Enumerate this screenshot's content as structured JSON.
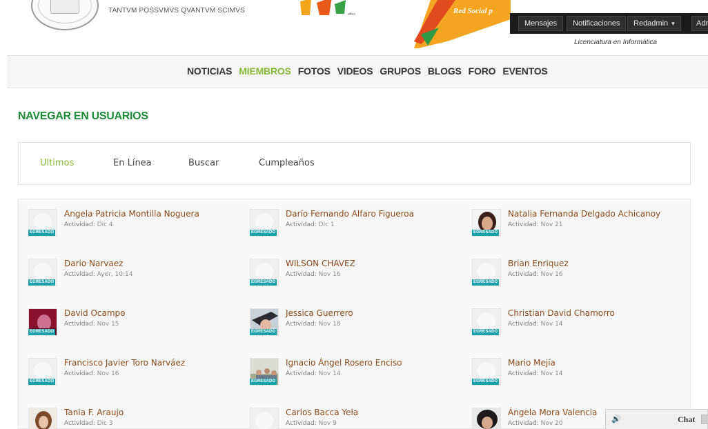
{
  "header": {
    "motto": "TANTVM POSSVMVS QVANTVM SCIMVS",
    "brand_title": "Red Social p",
    "brand_subtitle": "Licenciatura en Informática",
    "logo_suffix": "años"
  },
  "userbar": {
    "messages": "Mensajes",
    "notifications": "Notificaciones",
    "user": "Redadmin",
    "admin": "Adm"
  },
  "nav": {
    "items": [
      "NOTICIAS",
      "MIEMBROS",
      "FOTOS",
      "VIDEOS",
      "GRUPOS",
      "BLOGS",
      "FORO",
      "EVENTOS"
    ],
    "active": "MIEMBROS"
  },
  "page_title": "NAVEGAR EN USUARIOS",
  "filter_tabs": {
    "items": [
      "Ultimos",
      "En Línea",
      "Buscar",
      "Cumpleaños"
    ],
    "active": "Ultimos"
  },
  "activity_label": "Actividad:",
  "badge_label": "EGRESADO",
  "members": [
    {
      "name": "Angela Patricia Montilla Noguera",
      "activity": "Dic 4",
      "avatar": "placeholder",
      "badge": true
    },
    {
      "name": "Darío Fernando Alfaro Figueroa",
      "activity": "Dic 1",
      "avatar": "placeholder",
      "badge": true
    },
    {
      "name": "Natalia Fernanda Delgado Achicanoy",
      "activity": "Nov 21",
      "avatar": "photo-woman-dark-hair",
      "badge": true
    },
    {
      "name": "Dario Narvaez",
      "activity": "Ayer, 10:14",
      "avatar": "placeholder",
      "badge": true
    },
    {
      "name": "WILSON CHAVEZ",
      "activity": "Nov 16",
      "avatar": "placeholder",
      "badge": true
    },
    {
      "name": "Brian Enriquez",
      "activity": "Nov 16",
      "avatar": "placeholder",
      "badge": true
    },
    {
      "name": "David Ocampo",
      "activity": "Nov 15",
      "avatar": "photo-red-portrait",
      "badge": true
    },
    {
      "name": "Jessica Guerrero",
      "activity": "Nov 18",
      "avatar": "photo-woman-hat",
      "badge": true
    },
    {
      "name": "Christian David Chamorro",
      "activity": "Nov 14",
      "avatar": "placeholder",
      "badge": true
    },
    {
      "name": "Francisco Javier Toro Narváez",
      "activity": "Nov 16",
      "avatar": "placeholder",
      "badge": true
    },
    {
      "name": "Ignacio Ángel Rosero Enciso",
      "activity": "Nov 14",
      "avatar": "photo-group-outdoor",
      "badge": true
    },
    {
      "name": "Mario Mejía",
      "activity": "Nov 14",
      "avatar": "placeholder",
      "badge": true
    },
    {
      "name": "Tania F. Araujo",
      "activity": "Dic 3",
      "avatar": "photo-woman-light",
      "badge": false
    },
    {
      "name": "Carlos Bacca Yela",
      "activity": "Nov 9",
      "avatar": "placeholder",
      "badge": false
    },
    {
      "name": "Ángela Mora Valencia",
      "activity": "Nov 20",
      "avatar": "photo-woman-dark-hair-2",
      "badge": false
    }
  ],
  "chat": {
    "label": "Chat",
    "sound_icon": "speaker-icon"
  },
  "colors": {
    "nav_active": "#8ab938",
    "title_green": "#1e8a3a",
    "member_name": "#8a4a1a",
    "badge_teal": "#1aa0a8",
    "userbar_bg": "#1c1c1c"
  }
}
